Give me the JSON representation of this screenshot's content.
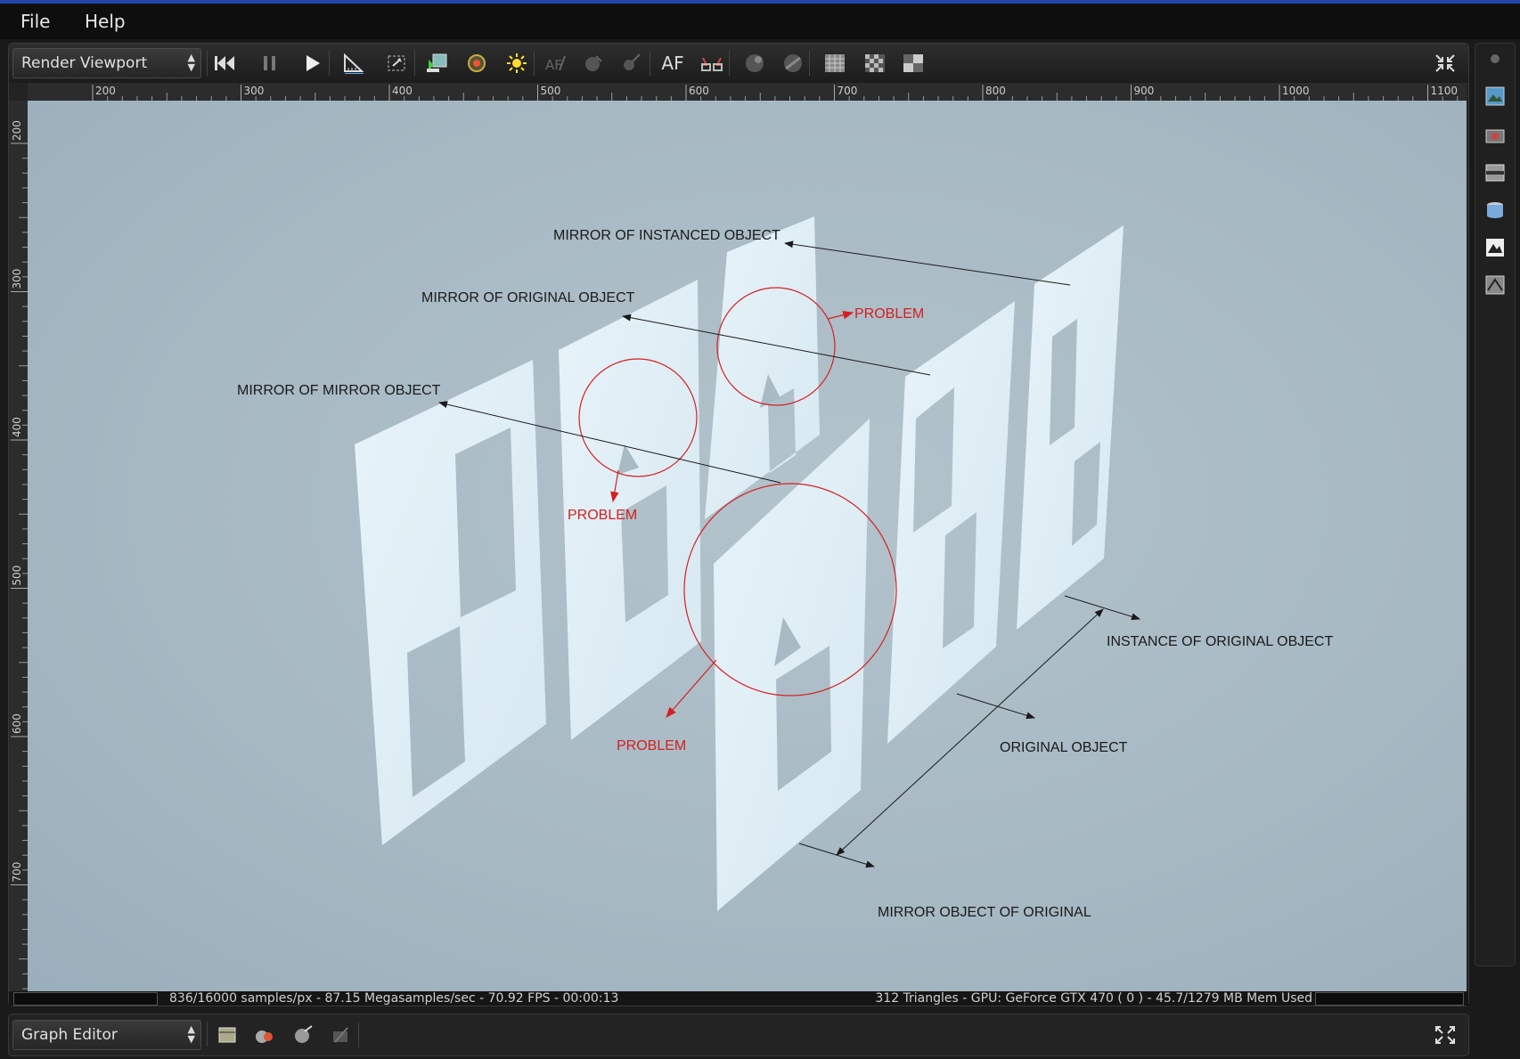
{
  "menu": {
    "file": "File",
    "help": "Help"
  },
  "viewport": {
    "selector_label": "Render Viewport",
    "af_label": "AF",
    "ruler_h": [
      "200",
      "300",
      "400",
      "500",
      "600",
      "700",
      "800",
      "900",
      "1000",
      "1100"
    ],
    "ruler_v": [
      "200",
      "300",
      "400",
      "500",
      "600",
      "700"
    ],
    "status_left": "836/16000 samples/px - 87.15 Megasamples/sec - 70.92 FPS - 00:00:13",
    "status_right": "312 Triangles - GPU: GeForce GTX 470 ( 0 ) - 45.7/1279 MB Mem Used"
  },
  "annotations": {
    "mirror_instanced": "MIRROR OF INSTANCED OBJECT",
    "mirror_original": "MIRROR OF ORIGINAL OBJECT",
    "mirror_mirror": "MIRROR OF MIRROR OBJECT",
    "problem_1": "PROBLEM",
    "problem_2": "PROBLEM",
    "problem_3": "PROBLEM",
    "instance_original": "INSTANCE OF ORIGINAL OBJECT",
    "original_object": "ORIGINAL OBJECT",
    "mirror_object_original": "MIRROR OBJECT OF ORIGINAL"
  },
  "colors": {
    "annotation_black": "#1a1a1a",
    "annotation_red": "#d42020",
    "panel_face": "#eaf5fb",
    "background": "#a6b8c2"
  },
  "graph_editor": {
    "selector_label": "Graph Editor"
  },
  "icons": [
    "first-frame-icon",
    "pause-icon",
    "play-icon",
    "ruler-icon",
    "fit-icon",
    "import-icon",
    "camera-target-icon",
    "sun-icon",
    "af-pick-icon",
    "material-icon",
    "focus-icon",
    "af-icon",
    "glasses-icon",
    "sphere-icon",
    "sphere-alt-icon",
    "grid-icon",
    "checker-icon",
    "split-icon",
    "minimize-icon"
  ]
}
